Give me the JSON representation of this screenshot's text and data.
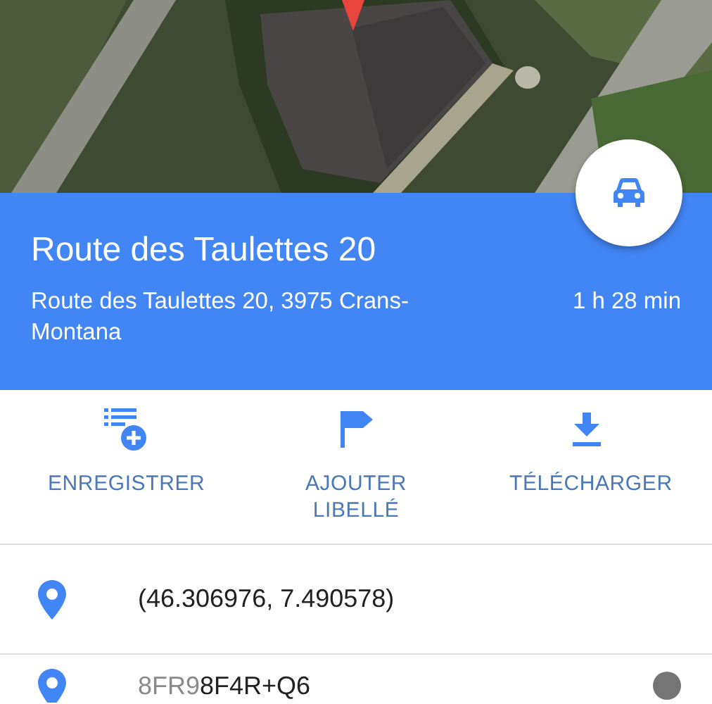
{
  "place": {
    "title": "Route des Taulettes 20",
    "address": "Route des Taulettes 20, 3975 Crans-Montana",
    "travel_time": "1 h 28 min"
  },
  "actions": [
    {
      "kind": "save",
      "label": "ENREGISTRER"
    },
    {
      "kind": "label",
      "label": "AJOUTER LIBELLÉ"
    },
    {
      "kind": "download",
      "label": "TÉLÉCHARGER"
    }
  ],
  "details": [
    {
      "kind": "coordinates",
      "text": "(46.306976, 7.490578)"
    },
    {
      "kind": "plus_code",
      "area": "8FR9",
      "text": "8F4R+Q6"
    }
  ]
}
